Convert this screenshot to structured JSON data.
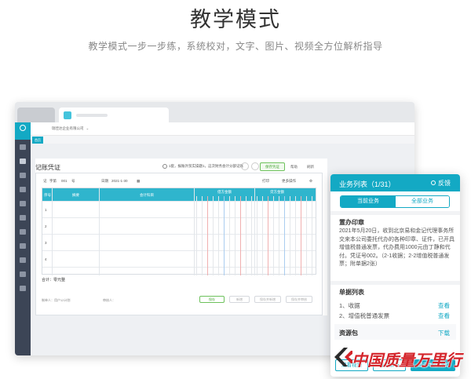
{
  "hero": {
    "title": "教学模式",
    "subtitle": "教学模式一步一步练，系统校对，文字、图片、视频全方位解析指导"
  },
  "colors": {
    "accent": "#13a9c4",
    "sidebar": "#3c4556",
    "green": "#6cc15b",
    "watermark_red": "#d4252b"
  },
  "app": {
    "company_select": "瑞佳达企业有限公司",
    "tab_label": "首页"
  },
  "voucher": {
    "title": "记账凭证",
    "hint": "1套，报账外贸实操题1，这次财务会计分部记账",
    "save_button": "保存凭证",
    "link_1": "帮助",
    "link_2": "刷新",
    "bar": {
      "word": "记",
      "num_label": "字第",
      "num": "001",
      "unit": "号",
      "date_label": "日期",
      "date": "2021-1-30",
      "attach": "附单据",
      "attach_unit": "张"
    },
    "bar_right_1": "打印",
    "bar_right_2": "更多操作",
    "headers": {
      "no": "序号",
      "summary": "摘要",
      "account": "会计科目",
      "debit": "借方金额",
      "credit": "贷方金额"
    },
    "rows": [
      "1",
      "2",
      "3",
      "4"
    ],
    "total_label": "合计：零元整",
    "foot_1": "制单人：用户12计划",
    "foot_2": "审核人：",
    "btn_1": "保存",
    "btn_2": "新增",
    "btn_3": "保存并新增",
    "btn_4": "保存并审核"
  },
  "tasks": {
    "title": "业务列表（1/31）",
    "feedback": "反馈",
    "seg_current": "当前业务",
    "seg_all": "全部业务",
    "section_title": "置办印章",
    "description": "2021年5月20日，收到北京易和金记代理事务所交来本公司委托代办的各种印章、证件，已开具增值税普通发票，代办费用1000元由丁静和代付。凭证号002。（2-1收据；2-2增值税普通发票；附单据2张）",
    "docs_title": "单据列表",
    "docs": [
      {
        "name": "1、收据",
        "action": "查看"
      },
      {
        "name": "2、增值税普通发票",
        "action": "查看"
      }
    ],
    "resource_title": "资源包",
    "resource_action": "下载",
    "btn_video": "观看视频",
    "btn_analysis": "查看解析",
    "btn_submit": "提交本题答案"
  },
  "watermark": {
    "text": "中国质量万里行"
  }
}
